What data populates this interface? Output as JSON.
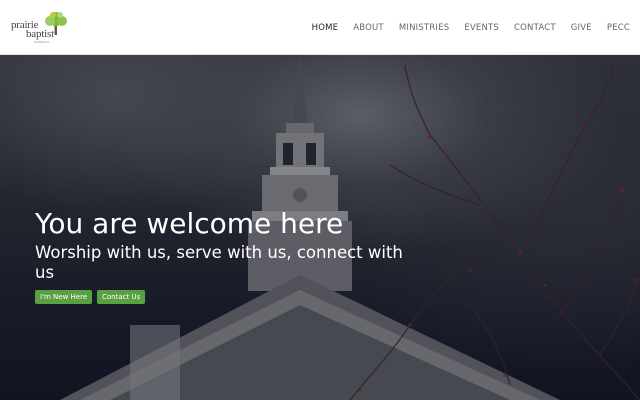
{
  "logo": {
    "line1": "prairie",
    "line2": "baptist",
    "sub": "CHURCH"
  },
  "nav": {
    "items": [
      {
        "label": "HOME",
        "active": true
      },
      {
        "label": "ABOUT"
      },
      {
        "label": "MINISTRIES"
      },
      {
        "label": "EVENTS"
      },
      {
        "label": "CONTACT"
      },
      {
        "label": "GIVE"
      },
      {
        "label": "PECC"
      }
    ]
  },
  "hero": {
    "title": "You are welcome here",
    "subtitle": "Worship with us, serve with us, connect with us",
    "buttons": {
      "new_here": "I'm New Here",
      "contact": "Contact Us"
    }
  },
  "colors": {
    "accent": "#59a042",
    "nav_text": "#666666",
    "nav_active": "#222222"
  }
}
